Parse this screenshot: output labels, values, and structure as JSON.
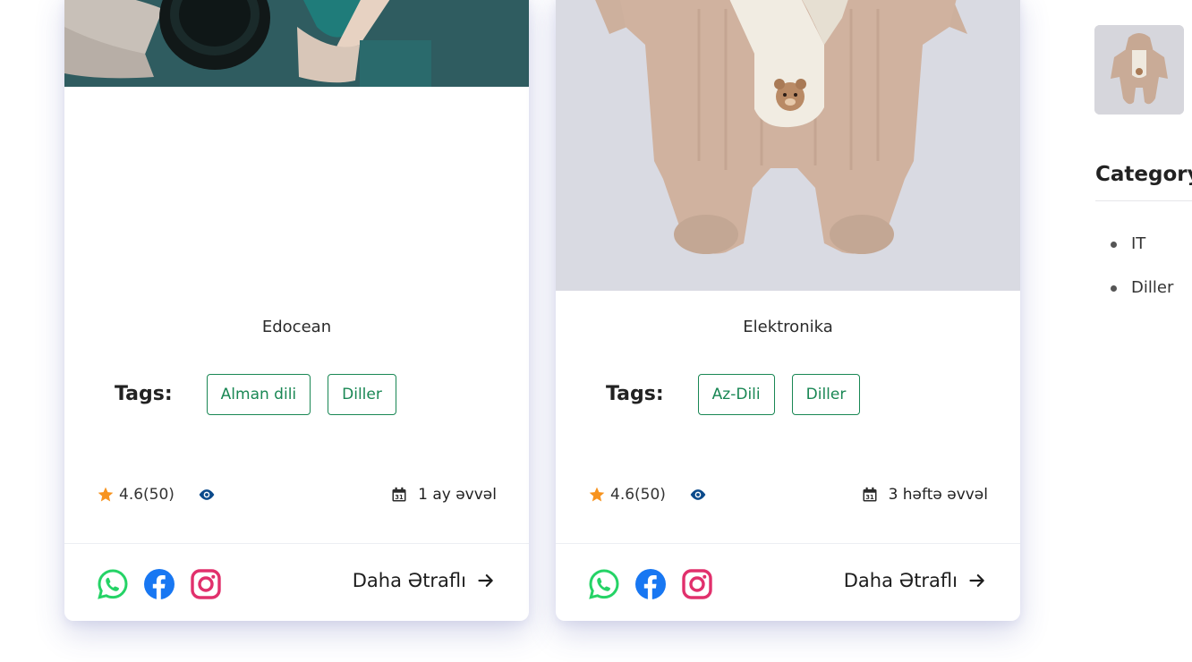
{
  "cards": [
    {
      "category": "Edocean",
      "tags_label": "Tags:",
      "tags": [
        "Alman dili",
        "Diller"
      ],
      "rating": "4.6(50)",
      "date": "1 ay əvvəl",
      "more_label": "Daha Ətraflı"
    },
    {
      "category": "Elektronika",
      "tags_label": "Tags:",
      "tags": [
        "Az-Dili",
        "Diller"
      ],
      "rating": "4.6(50)",
      "date": "3 həftə əvvəl",
      "more_label": "Daha Ətraflı"
    }
  ],
  "sidebar": {
    "category_title": "Category",
    "categories": [
      "IT",
      "Diller"
    ]
  },
  "icons": {
    "rating": "star-icon",
    "views": "eye-icon",
    "date": "calendar-icon",
    "social": [
      "whatsapp-icon",
      "facebook-icon",
      "instagram-icon"
    ],
    "more": "arrow-right-icon"
  },
  "colors": {
    "tag_green": "#198754",
    "star_orange": "#f7931e",
    "eye_blue": "#0b4a8b",
    "whatsapp": "#25d366",
    "facebook": "#1877f2",
    "instagram": "#e1306c"
  }
}
